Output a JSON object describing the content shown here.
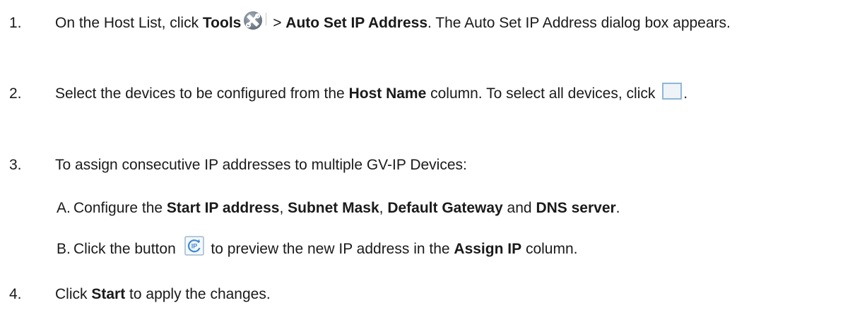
{
  "steps": [
    {
      "num": "1.",
      "parts": {
        "t1": "On the Host List, click ",
        "b1": "Tools",
        "t2": " > ",
        "b2": "Auto Set IP Address",
        "t3": ". The Auto Set IP Address dialog box appears."
      }
    },
    {
      "num": "2.",
      "parts": {
        "t1": "Select the devices to be configured from the ",
        "b1": "Host Name",
        "t2": " column. To select all devices, click ",
        "t3": "."
      }
    },
    {
      "num": "3.",
      "parts": {
        "t1": "To assign consecutive IP addresses to multiple GV-IP Devices:"
      }
    },
    {
      "num": "4.",
      "parts": {
        "t1": "Click ",
        "b1": "Start",
        "t2": " to apply the changes."
      }
    }
  ],
  "substeps": [
    {
      "letter": "A.",
      "parts": {
        "t1": "Configure  the ",
        "b1": "Start IP address",
        "t2": ", ",
        "b2": "Subnet Mask",
        "t3": ", ",
        "b3": "Default Gateway",
        "t4": " and ",
        "b4": "DNS server",
        "t5": "."
      }
    },
    {
      "letter": "B.",
      "parts": {
        "t1": "Click the button ",
        "t2": " to preview the new IP address in the ",
        "b1": "Assign IP",
        "t3": " column."
      }
    }
  ],
  "icons": {
    "tools": "tools-icon",
    "select_all": "checkbox-icon",
    "assign_ip": "ip-refresh-icon"
  },
  "colors": {
    "text": "#1a1a1a",
    "tools_icon": "#7f8a97",
    "checkbox_border": "#8fb6d8",
    "ip_icon": "#3d89d6"
  }
}
